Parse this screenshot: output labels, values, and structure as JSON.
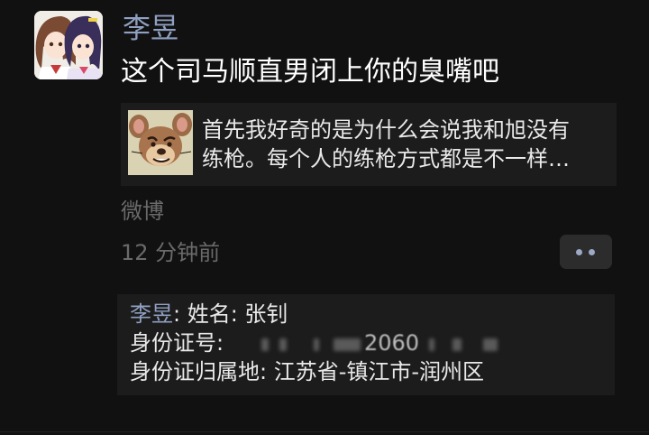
{
  "post": {
    "author": "李昱",
    "text": "这个司马顺直男闭上你的臭嘴吧",
    "avatar_icon": "anime-girls-avatar",
    "share": {
      "thumb_icon": "cartoon-mouse-thumbnail",
      "line1": "首先我好奇的是为什么会说我和旭没有",
      "line2": "练枪。每个人的练枪方式都是不一样…"
    },
    "source": "微博",
    "time": "12 分钟前",
    "more_icon": "more-dots-icon"
  },
  "comment": {
    "author": "李昱",
    "colon": ":",
    "line1_rest": " 姓名:  张钊",
    "line2_label": "身份证号:",
    "line2_visible": "2060",
    "line3": "身份证归属地:   江苏省-镇江市-润州区"
  },
  "colors": {
    "background": "#111111",
    "card": "#1c1c1c",
    "name_blue": "#8fa0c2",
    "secondary_gray": "#6a6a6a",
    "button_bg": "#2c2c2c"
  }
}
